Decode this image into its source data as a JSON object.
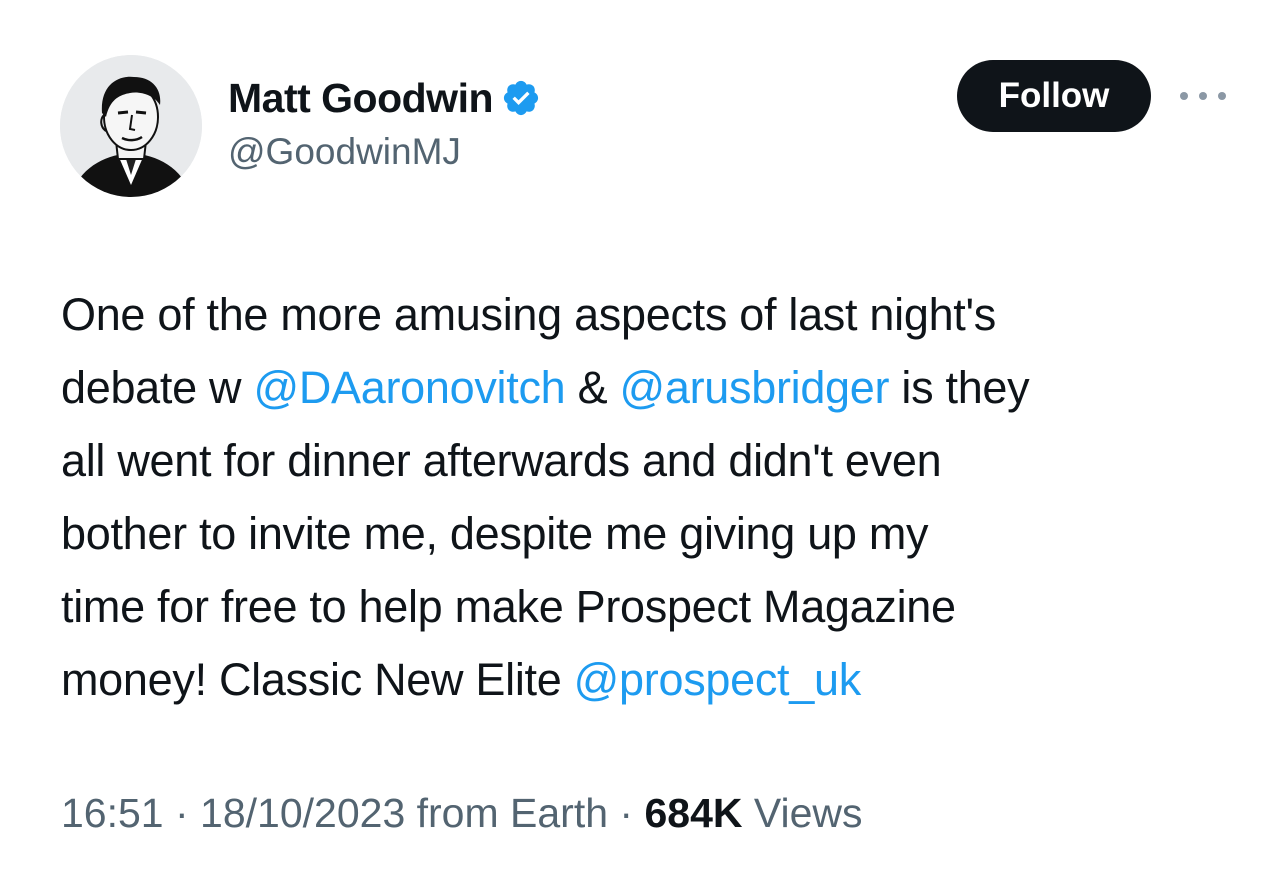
{
  "author": {
    "display_name": "Matt Goodwin",
    "handle": "@GoodwinMJ",
    "verified_icon": "verified-badge-icon",
    "avatar_icon": "avatar-portrait"
  },
  "actions": {
    "follow_label": "Follow",
    "more_icon": "more-options-icon"
  },
  "tweet": {
    "line1": "One of the more amusing aspects of last night's",
    "line2_pre": "debate w ",
    "mention1": "@DAaronovitch",
    "line2_mid": " & ",
    "mention2": "@arusbridger",
    "line2_post": " is they",
    "line3": "all went for dinner afterwards and didn't even",
    "line4": "bother to invite me, despite me giving up my",
    "line5": "time for free to help make Prospect Magazine",
    "line6_pre": "money! Classic New Elite ",
    "mention3": "@prospect_uk"
  },
  "meta": {
    "time": "16:51",
    "separator1": " · ",
    "date": "18/10/2023",
    "source": " from Earth",
    "separator2": " · ",
    "views_count": "684K",
    "views_label": " Views"
  },
  "colors": {
    "text": "#0f1419",
    "secondary": "#536471",
    "link": "#1d9bf0",
    "follow_bg": "#0f1419"
  }
}
